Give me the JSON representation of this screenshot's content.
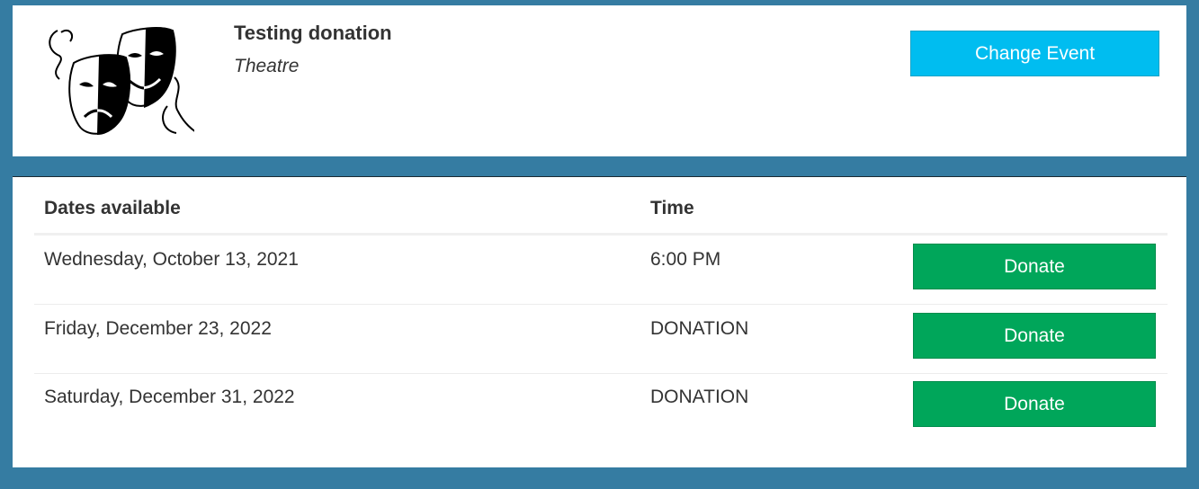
{
  "event": {
    "title": "Testing donation",
    "category": "Theatre",
    "logo_icon": "theatre-masks-icon",
    "change_button_label": "Change Event"
  },
  "table": {
    "headers": {
      "dates": "Dates available",
      "time": "Time"
    },
    "rows": [
      {
        "date": "Wednesday, October 13, 2021",
        "time": "6:00 PM",
        "action": "Donate"
      },
      {
        "date": "Friday, December 23, 2022",
        "time": "DONATION",
        "action": "Donate"
      },
      {
        "date": "Saturday, December 31, 2022",
        "time": "DONATION",
        "action": "Donate"
      }
    ]
  },
  "colors": {
    "background": "#357ca2",
    "change_button": "#00bdf0",
    "donate_button": "#00a65a"
  }
}
